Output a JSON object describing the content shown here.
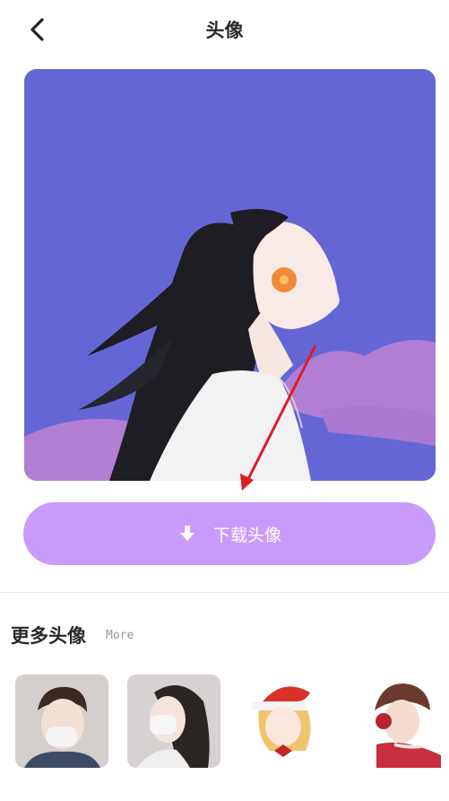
{
  "header": {
    "title": "头像",
    "back_icon": "chevron-left-icon"
  },
  "hero": {
    "description_icon": "avatar-girl-illustration"
  },
  "download": {
    "label": "下载头像",
    "icon": "download-arrow-icon"
  },
  "more": {
    "title": "更多头像",
    "subtitle": "More"
  },
  "colors": {
    "hero_bg": "#6566d6",
    "button_bg": "#c99bfb",
    "cloud": "#b27ed3"
  }
}
